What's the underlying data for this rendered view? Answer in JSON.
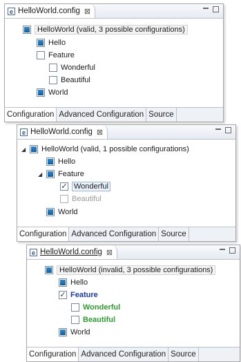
{
  "panels": [
    {
      "tab_title": "HelloWorld.config",
      "close_glyph": "⊠",
      "root_label": "HelloWorld (valid, 3 possible configurations)",
      "items": [
        "Hello",
        "Feature",
        "Wonderful",
        "Beautiful",
        "World"
      ],
      "bottom_tabs": [
        "Configuration",
        "Advanced Configuration",
        "Source"
      ]
    },
    {
      "tab_title": "HelloWorld.config",
      "close_glyph": "⊠",
      "root_label": "HelloWorld (valid, 1 possible configurations)",
      "items": [
        "Hello",
        "Feature",
        "Wonderful",
        "Beautiful",
        "World"
      ],
      "bottom_tabs": [
        "Configuration",
        "Advanced Configuration",
        "Source"
      ]
    },
    {
      "tab_title": "HelloWorld.config",
      "close_glyph": "⊠",
      "root_label": "HelloWorld (invalid, 3 possible configurations)",
      "items": [
        "Hello",
        "Feature",
        "Wonderful",
        "Beautiful",
        "World"
      ],
      "bottom_tabs": [
        "Configuration",
        "Advanced Configuration",
        "Source"
      ]
    }
  ],
  "icons": {
    "editor": "e",
    "expand_triangle": "◢",
    "check": "✓"
  },
  "colors": {
    "selected_fill": "#0b5ea8",
    "invalid_feature": "#1736a8",
    "invalid_children": "#2c9a2c"
  }
}
